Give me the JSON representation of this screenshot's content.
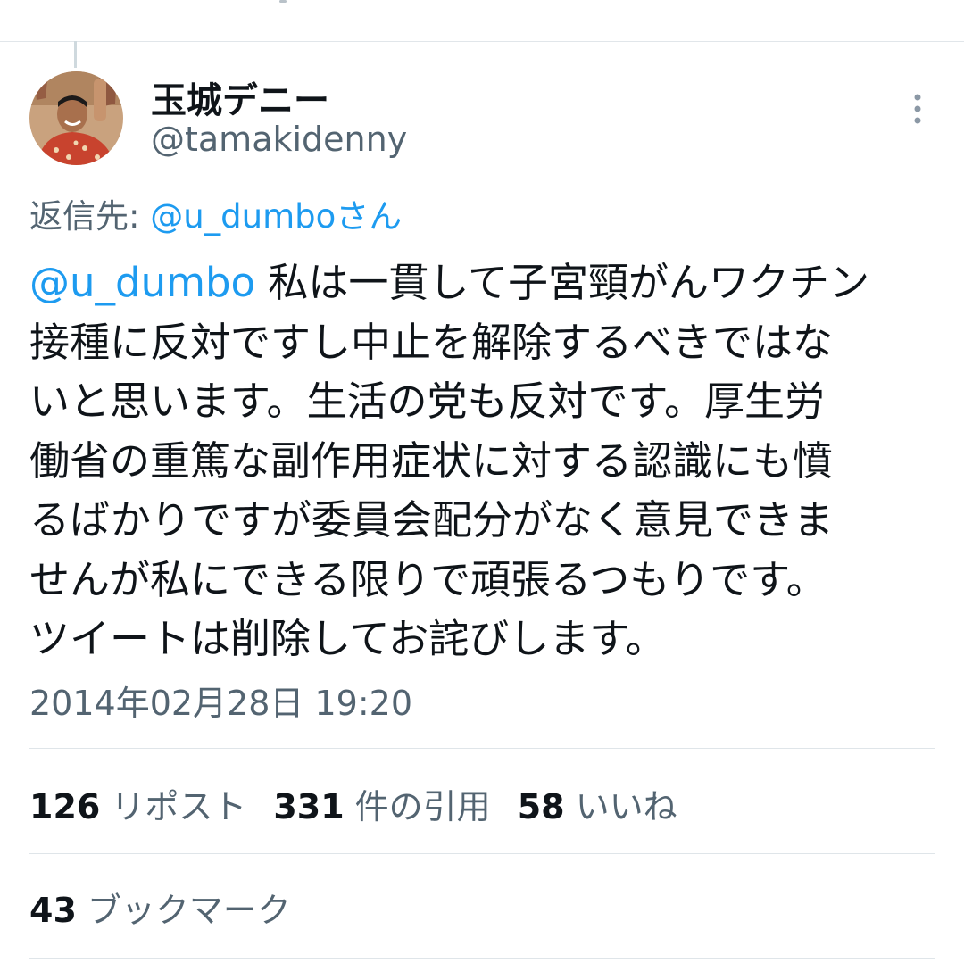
{
  "tweet": {
    "author": {
      "display_name": "玉城デニー",
      "handle": "@tamakidenny"
    },
    "reply_to": {
      "prefix": "返信先: ",
      "mention": "@u_dumbo",
      "suffix": "さん"
    },
    "body": {
      "mention": "@u_dumbo",
      "first_line_rest": " 私は一貫して子宮頸がんワクチン",
      "lines": [
        "接種に反対ですし中止を解除するべきではな",
        "いと思います。生活の党も反対です。厚生労",
        "働省の重篤な副作用症状に対する認識にも憤",
        "るばかりですが委員会配分がなく意見できま",
        "せんが私にできる限りで頑張るつもりです。",
        "ツイートは削除してお詫びします。"
      ]
    },
    "timestamp": "2014年02月28日 19:20",
    "stats": {
      "reposts": {
        "count": "126",
        "label": "リポスト"
      },
      "quotes": {
        "count": "331",
        "label": "件の引用"
      },
      "likes": {
        "count": "58",
        "label": "いいね"
      },
      "bookmarks": {
        "count": "43",
        "label": "ブックマーク"
      }
    }
  },
  "icons": {
    "more": "more-vertical-icon",
    "avatar": "profile-photo"
  },
  "colors": {
    "text_primary": "#0f1419",
    "text_secondary": "#536471",
    "link": "#1d9bf0",
    "divider": "#dfe5e9"
  }
}
